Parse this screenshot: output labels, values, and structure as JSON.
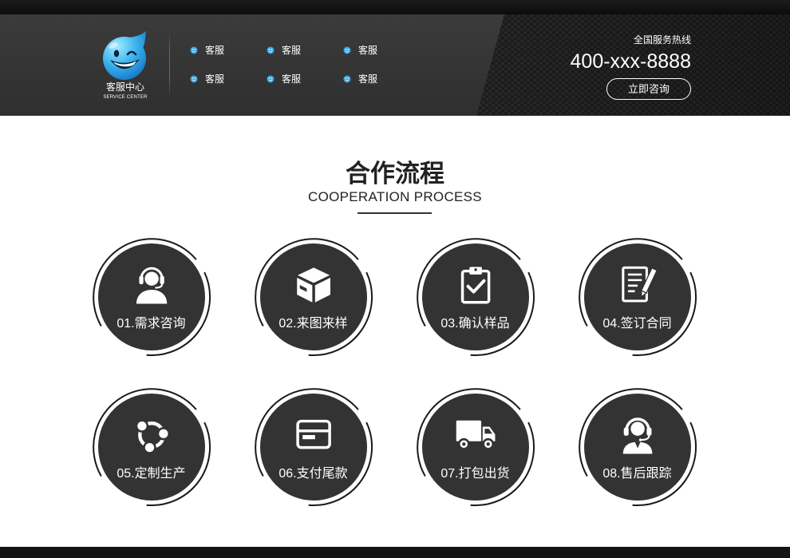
{
  "header": {
    "logo": {
      "title": "客服中心",
      "subtitle": "SERVICE CENTER",
      "icon": "logo-mascot-icon"
    },
    "service_items": [
      {
        "label": "客服",
        "icon": "chat-icon"
      },
      {
        "label": "客服",
        "icon": "chat-icon"
      },
      {
        "label": "客服",
        "icon": "chat-icon"
      },
      {
        "label": "客服",
        "icon": "chat-icon"
      },
      {
        "label": "客服",
        "icon": "chat-icon"
      },
      {
        "label": "客服",
        "icon": "chat-icon"
      }
    ],
    "hotline": {
      "label": "全国服务热线",
      "phone": "400-xxx-8888",
      "button_label": "立即咨询"
    }
  },
  "section": {
    "title": "合作流程",
    "subtitle": "COOPERATION PROCESS"
  },
  "steps": [
    {
      "label": "01.需求咨询",
      "icon": "headset-person-icon"
    },
    {
      "label": "02.来图来样",
      "icon": "box-icon"
    },
    {
      "label": "03.确认样品",
      "icon": "clipboard-check-icon"
    },
    {
      "label": "04.签订合同",
      "icon": "contract-icon"
    },
    {
      "label": "05.定制生产",
      "icon": "share-network-icon"
    },
    {
      "label": "06.支付尾款",
      "icon": "card-icon"
    },
    {
      "label": "07.打包出货",
      "icon": "truck-icon"
    },
    {
      "label": "08.售后跟踪",
      "icon": "support-agent-icon"
    }
  ],
  "colors": {
    "header_bg": "#333333",
    "circle_bg": "#333333",
    "ring": "#1a1a1a",
    "title_text": "#222222",
    "accent_blue": "#3aa6e8",
    "white": "#ffffff"
  }
}
